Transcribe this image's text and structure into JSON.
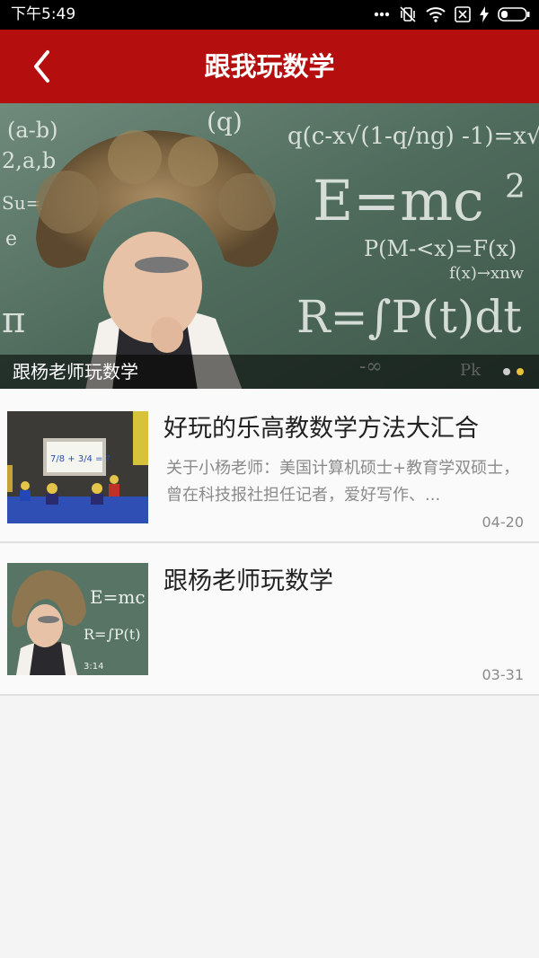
{
  "status_bar": {
    "time": "下午5:49",
    "icons": [
      "more-dots-icon",
      "vibrate-off-icon",
      "wifi-icon",
      "sim-x-icon",
      "charging-icon",
      "battery-icon"
    ]
  },
  "app_bar": {
    "title": "跟我玩数学",
    "back_icon": "chevron-left-icon",
    "color": "#b50e0e"
  },
  "banner": {
    "caption": "跟杨老师玩数学",
    "dots": {
      "count": 2,
      "active_index": 1,
      "active_color": "#e8c23a",
      "inactive_color": "#cccccc"
    },
    "chalk": {
      "top1": "(a-b)",
      "top2": "(q)",
      "top3": "q(c-x√(1-q/ng) -1)=x√",
      "left1": "2,a,b",
      "left2": "Su=A",
      "left3": "e",
      "emc": "E=mc",
      "emc_sup": "2",
      "p_eq": "P(M-<x)=F(x)",
      "fx": "f(x)→xnw",
      "r_eq": "R=∫P(t)dt",
      "inf": "-∞",
      "pi": "π",
      "pk": "Pk"
    }
  },
  "articles": [
    {
      "title": "好玩的乐高教数学方法大汇合",
      "summary": "关于小杨老师：美国计算机硕士+教育学双硕士，曾在科技报社担任记者，爱好写作、...",
      "date": "04-20",
      "board_text": "7/8 + 3/4 = ?"
    },
    {
      "title": "跟杨老师玩数学",
      "summary": "",
      "date": "03-31",
      "chalk_emc": "E=mc",
      "chalk_r": "R=∫P(t)",
      "chalk_num": "3:14"
    }
  ]
}
